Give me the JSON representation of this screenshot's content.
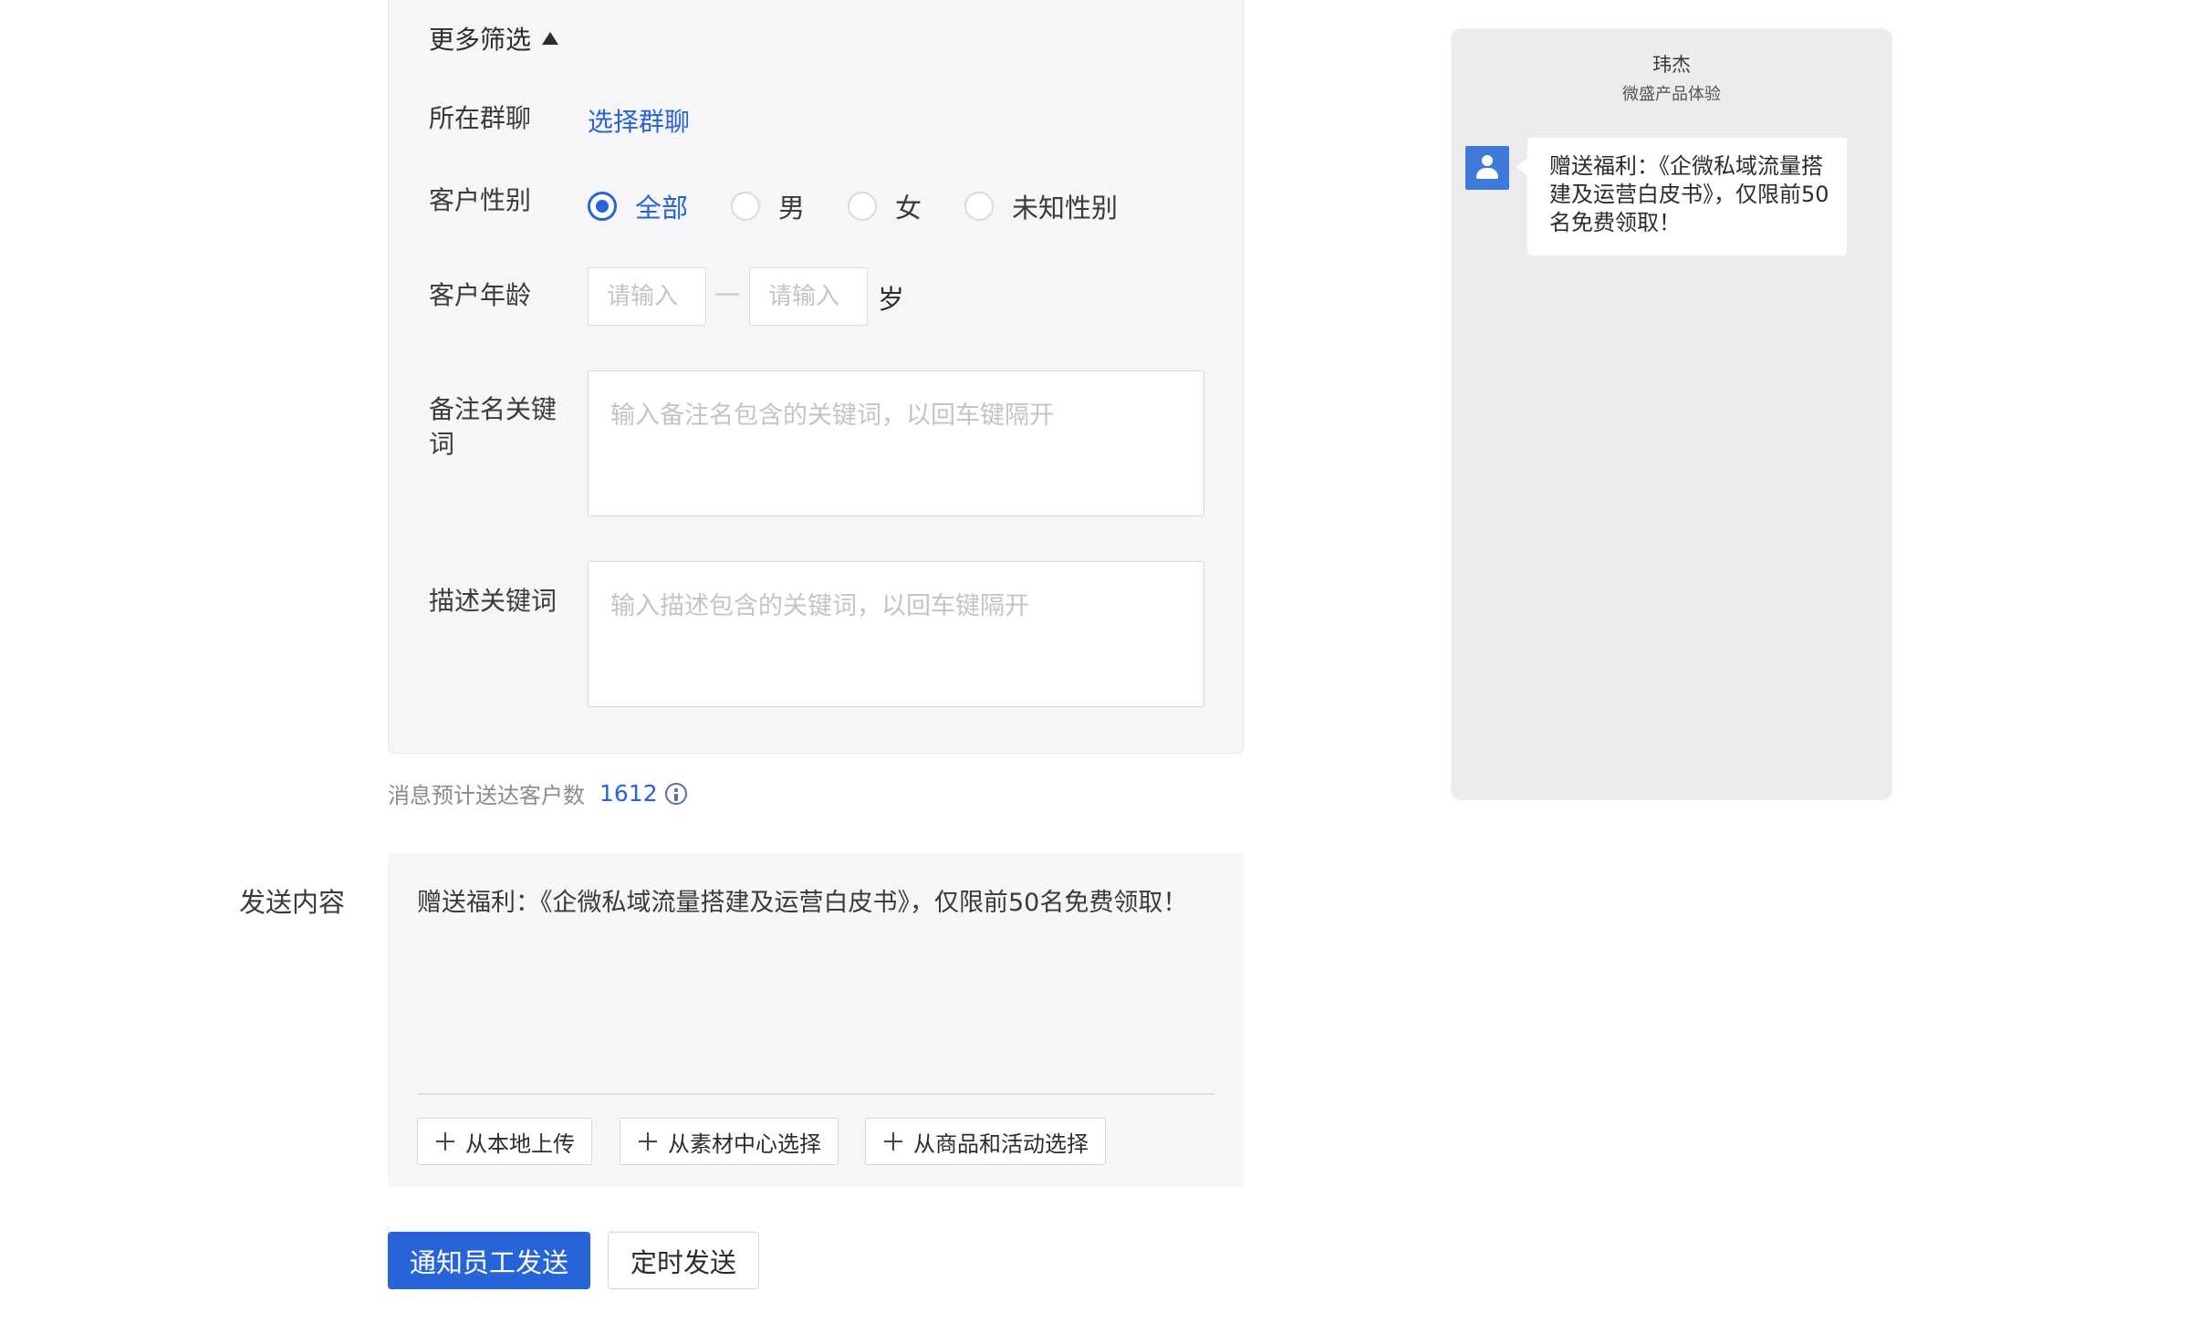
{
  "filters": {
    "more_filter_label": "更多筛选",
    "group_chat": {
      "label": "所在群聊",
      "link": "选择群聊"
    },
    "gender": {
      "label": "客户性别",
      "options": [
        "全部",
        "男",
        "女",
        "未知性别"
      ],
      "selected": "全部"
    },
    "age": {
      "label": "客户年龄",
      "min_placeholder": "请输入",
      "max_placeholder": "请输入",
      "separator": "—",
      "unit": "岁"
    },
    "remark_keywords": {
      "label_line1": "备注名关键",
      "label_line2": "词",
      "placeholder": "输入备注名包含的关键词，以回车键隔开"
    },
    "description_keywords": {
      "label": "描述关键词",
      "placeholder": "输入描述包含的关键词，以回车键隔开"
    }
  },
  "estimate": {
    "label": "消息预计送达客户数",
    "count": "1612"
  },
  "send_content": {
    "label": "发送内容",
    "text": "赠送福利：《企微私域流量搭建及运营白皮书》，仅限前50名免费领取！",
    "buttons": {
      "upload_local": "从本地上传",
      "from_material": "从素材中心选择",
      "from_goods": "从商品和活动选择"
    }
  },
  "actions": {
    "notify_send": "通知员工发送",
    "scheduled_send": "定时发送"
  },
  "preview": {
    "name": "玮杰",
    "company": "微盛产品体验",
    "message": "赠送福利：《企微私域流量搭建及运营白皮书》，仅限前50名免费领取！"
  },
  "colors": {
    "accent": "#2764d8",
    "panel_bg": "#f6f6f8",
    "preview_bg": "#ececee",
    "avatar": "#3f7ad9"
  }
}
